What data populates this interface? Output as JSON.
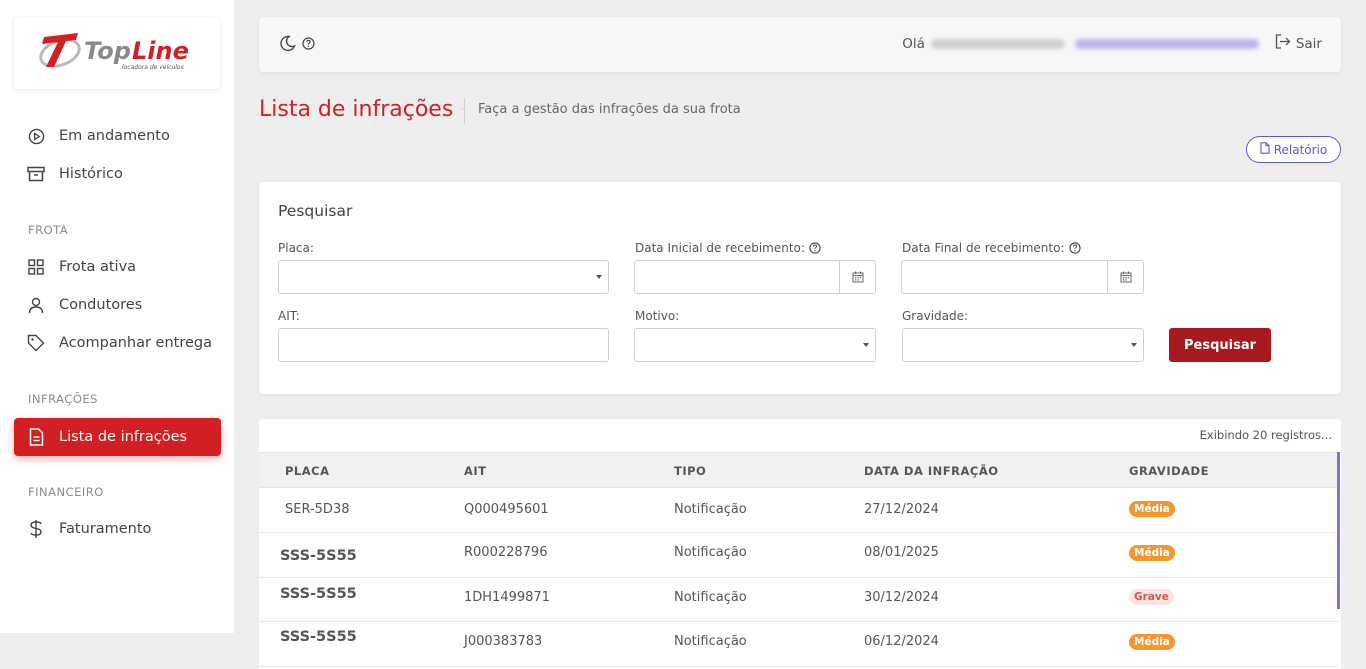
{
  "logo": {
    "brand": "TopLine",
    "tagline": "locadora de veículos"
  },
  "sidebar": {
    "items_top": [
      {
        "label": "Em andamento",
        "icon": "play-circle-icon"
      },
      {
        "label": "Histórico",
        "icon": "archive-icon"
      }
    ],
    "sections": [
      {
        "title": "FROTA",
        "items": [
          {
            "label": "Frota ativa",
            "icon": "grid-icon"
          },
          {
            "label": "Condutores",
            "icon": "user-icon"
          },
          {
            "label": "Acompanhar entrega",
            "icon": "tag-icon"
          }
        ]
      },
      {
        "title": "INFRAÇÕES",
        "items": [
          {
            "label": "Lista de infrações",
            "icon": "document-icon",
            "active": true
          }
        ]
      },
      {
        "title": "FINANCEIRO",
        "items": [
          {
            "label": "Faturamento",
            "icon": "dollar-icon"
          }
        ]
      }
    ]
  },
  "topbar": {
    "greeting": "Olá",
    "logout_label": "Sair"
  },
  "page": {
    "title": "Lista de infrações",
    "subtitle": "Faça a gestão das infrações da sua frota",
    "report_label": "Relatório"
  },
  "search": {
    "title": "Pesquisar",
    "placa_label": "Placa:",
    "data_inicial_label": "Data Inicial de recebimento:",
    "data_final_label": "Data Final de recebimento:",
    "ait_label": "AIT:",
    "motivo_label": "Motivo:",
    "gravidade_label": "Gravidade:",
    "button_label": "Pesquisar"
  },
  "table": {
    "records_text": "Exibindo 20 registros...",
    "columns": [
      "PLACA",
      "AIT",
      "TIPO",
      "DATA DA INFRAÇÃO",
      "GRAVIDADE"
    ],
    "rows": [
      {
        "placa": "SER-5D38",
        "ait": "Q000495601",
        "tipo": "Notificação",
        "data": "27/12/2024",
        "gravidade": "Média"
      },
      {
        "placa": "SSS-5S55",
        "ait": "R000228796",
        "tipo": "Notificação",
        "data": "08/01/2025",
        "gravidade": "Média"
      },
      {
        "placa": "SSS-5S55",
        "ait": "1DH1499871",
        "tipo": "Notificação",
        "data": "30/12/2024",
        "gravidade": "Grave"
      },
      {
        "placa": "SSS-5S55",
        "ait": "J000383783",
        "tipo": "Notificação",
        "data": "06/12/2024",
        "gravidade": "Média"
      }
    ]
  },
  "colors": {
    "brand_red": "#d11f24",
    "button_red": "#a8191f",
    "accent_purple": "#5c59c9",
    "badge_media": "#f5962f",
    "badge_grave_bg": "#fbe4e4"
  }
}
